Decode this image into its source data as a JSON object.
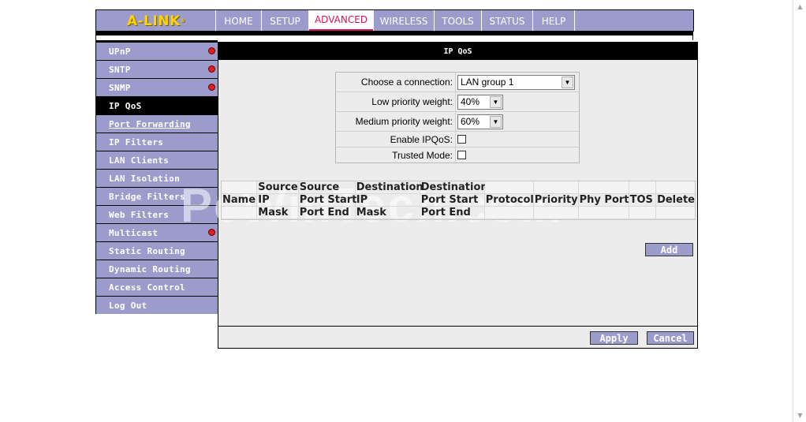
{
  "brand": {
    "logo": "A-LINK",
    "trademark": "®"
  },
  "top_nav": {
    "tabs": [
      {
        "label": "HOME",
        "active": false
      },
      {
        "label": "SETUP",
        "active": false
      },
      {
        "label": "ADVANCED",
        "active": true
      },
      {
        "label": "WIRELESS",
        "active": false
      },
      {
        "label": "TOOLS",
        "active": false
      },
      {
        "label": "STATUS",
        "active": false
      },
      {
        "label": "HELP",
        "active": false
      }
    ]
  },
  "sidebar": {
    "items": [
      {
        "label": "UPnP",
        "dot": true
      },
      {
        "label": "SNTP",
        "dot": true
      },
      {
        "label": "SNMP",
        "dot": true
      },
      {
        "label": "IP QoS",
        "active": true
      },
      {
        "label": "Port Forwarding",
        "underline": true
      },
      {
        "label": "IP Filters"
      },
      {
        "label": "LAN Clients"
      },
      {
        "label": "LAN Isolation"
      },
      {
        "label": "Bridge Filters"
      },
      {
        "label": "Web Filters"
      },
      {
        "label": "Multicast",
        "dot": true
      },
      {
        "label": "Static Routing"
      },
      {
        "label": "Dynamic Routing"
      },
      {
        "label": "Access Control"
      },
      {
        "label": "Log Out"
      }
    ]
  },
  "panel": {
    "title": "IP QoS"
  },
  "form": {
    "connection_label": "Choose a connection:",
    "connection_value": "LAN group 1",
    "low_label": "Low priority weight:",
    "low_value": "40%",
    "medium_label": "Medium priority weight:",
    "medium_value": "60%",
    "enable_label": "Enable IPQoS:",
    "trusted_label": "Trusted Mode:"
  },
  "table": {
    "columns": [
      {
        "lines": [
          "",
          "Name",
          ""
        ]
      },
      {
        "lines": [
          "Source",
          "IP",
          "Mask"
        ]
      },
      {
        "lines": [
          "Source",
          "Port Start",
          "Port End"
        ]
      },
      {
        "lines": [
          "Destination",
          "IP",
          "Mask"
        ]
      },
      {
        "lines": [
          "Destination",
          "Port Start",
          "Port End"
        ]
      },
      {
        "lines": [
          "",
          "Protocol",
          ""
        ]
      },
      {
        "lines": [
          "",
          "Priority",
          ""
        ]
      },
      {
        "lines": [
          "",
          "Phy Port",
          ""
        ]
      },
      {
        "lines": [
          "",
          "TOS",
          ""
        ]
      },
      {
        "lines": [
          "",
          "Delete",
          ""
        ]
      }
    ]
  },
  "buttons": {
    "add": "Add",
    "apply": "Apply",
    "cancel": "Cancel"
  },
  "watermark": "PcWinTech.com",
  "colors": {
    "nav_bg": "#9c9ccc",
    "accent": "#d4145a",
    "logo": "#ffd200",
    "status_dot": "#e02020"
  }
}
